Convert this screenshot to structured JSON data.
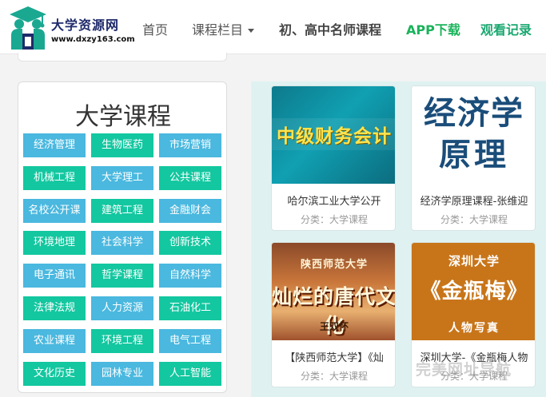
{
  "header": {
    "logo_title": "大学资源网",
    "logo_url": "www.dxzy163.com",
    "nav": {
      "home": "首页",
      "columns": "课程栏目",
      "teachers": "初、高中名师课程",
      "app": "APP下载",
      "history": "观看记录"
    }
  },
  "colors": {
    "blue_btn": "#4ab8df",
    "green_btn": "#13c7a0",
    "app_green": "#19b35a",
    "panel_bg": "#dff2f1"
  },
  "sidebar": {
    "title": "大学课程",
    "categories": [
      {
        "label": "经济管理",
        "color": "blue"
      },
      {
        "label": "生物医药",
        "color": "green"
      },
      {
        "label": "市场营销",
        "color": "blue"
      },
      {
        "label": "机械工程",
        "color": "green"
      },
      {
        "label": "大学理工",
        "color": "blue"
      },
      {
        "label": "公共课程",
        "color": "green"
      },
      {
        "label": "名校公开课",
        "color": "blue"
      },
      {
        "label": "建筑工程",
        "color": "green"
      },
      {
        "label": "金融财会",
        "color": "blue"
      },
      {
        "label": "环境地理",
        "color": "green"
      },
      {
        "label": "社会科学",
        "color": "blue"
      },
      {
        "label": "创新技术",
        "color": "green"
      },
      {
        "label": "电子通讯",
        "color": "blue"
      },
      {
        "label": "哲学课程",
        "color": "green"
      },
      {
        "label": "自然科学",
        "color": "blue"
      },
      {
        "label": "法律法规",
        "color": "green"
      },
      {
        "label": "人力资源",
        "color": "blue"
      },
      {
        "label": "石油化工",
        "color": "green"
      },
      {
        "label": "农业课程",
        "color": "blue"
      },
      {
        "label": "环境工程",
        "color": "green"
      },
      {
        "label": "电气工程",
        "color": "blue"
      },
      {
        "label": "文化历史",
        "color": "green"
      },
      {
        "label": "园林专业",
        "color": "blue"
      },
      {
        "label": "人工智能",
        "color": "green"
      }
    ]
  },
  "courses": [
    {
      "thumb_text": "中级财务会计",
      "title": "哈尔滨工业大学公开",
      "category": "分类：大学课程"
    },
    {
      "thumb_line1": "经济学",
      "thumb_line2": "原理",
      "title": "经济学原理课程-张维迎",
      "category": "分类：大学课程"
    },
    {
      "thumb_sub": "陕西师范大学",
      "thumb_main": "灿烂的唐代文化",
      "thumb_name": "王双怀",
      "title": "【陕西师范大学】《灿",
      "category": "分类：大学课程"
    },
    {
      "thumb_sub": "深圳大学",
      "thumb_main": "《金瓶梅》",
      "thumb_foot": "人物写真",
      "title": "深圳大学-《金瓶梅人物",
      "category": "分类：大学课程"
    }
  ],
  "watermark": "完美网址导航"
}
